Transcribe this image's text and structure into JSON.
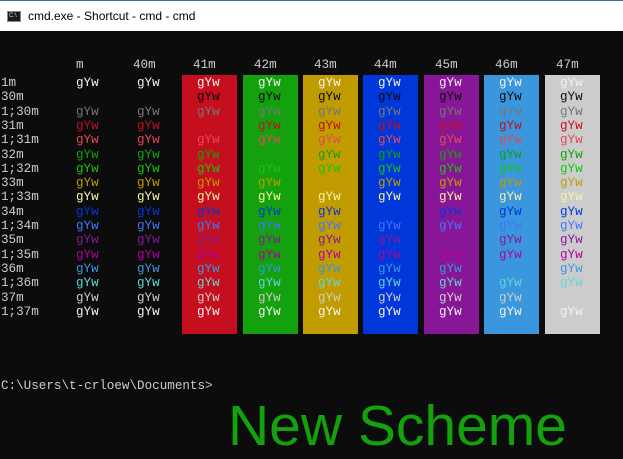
{
  "window": {
    "title": "cmd.exe - Shortcut - cmd - cmd",
    "icon": "console-icon"
  },
  "table": {
    "sample": "gYw",
    "row_labels": [
      "1m",
      "30m",
      "1;30m",
      "31m",
      "1;31m",
      "32m",
      "1;32m",
      "33m",
      "1;33m",
      "34m",
      "1;34m",
      "35m",
      "1;35m",
      "36m",
      "1;36m",
      "37m",
      "1;37m"
    ],
    "columns": [
      "m",
      "40m",
      "41m",
      "42m",
      "43m",
      "44m",
      "45m",
      "46m",
      "47m"
    ],
    "default_fg": "#cccccc",
    "fg_colors": [
      "#f2f2f2",
      "#0c0c0c",
      "#767676",
      "#c50f1f",
      "#e74856",
      "#13a10e",
      "#16c60c",
      "#c19c00",
      "#f9f1a5",
      "#0037da",
      "#3b78ff",
      "#881798",
      "#b4009e",
      "#3a96dd",
      "#61d6d6",
      "#cccccc",
      "#f2f2f2"
    ],
    "bg_colors": [
      null,
      "#0c0c0c",
      "#c50f1f",
      "#13a10e",
      "#c19c00",
      "#0037da",
      "#881798",
      "#3a96dd",
      "#cccccc"
    ]
  },
  "prompt": "C:\\Users\\t-crloew\\Documents>",
  "overlay_text": "New Scheme"
}
